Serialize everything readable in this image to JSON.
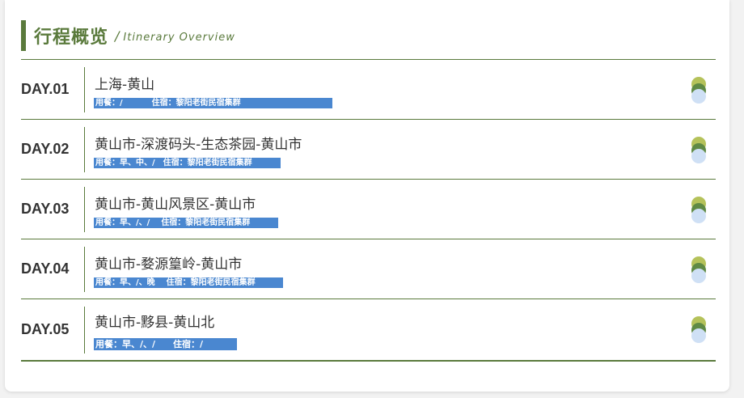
{
  "header": {
    "title": "行程概览",
    "separator": "/",
    "subtitle": "Itinerary Overview"
  },
  "colors": {
    "accent": "#5a7a3c",
    "meta_bg": "#4a87d0",
    "dot_top": "#b5c25a",
    "dot_mid": "#5f8a45",
    "dot_bottom": "#cfe0f5"
  },
  "days": [
    {
      "day": "DAY.01",
      "route": "上海-黄山",
      "meals_label": "用餐：/",
      "stay_label": "住宿：黎阳老街民宿集群",
      "icon": "dots-icon"
    },
    {
      "day": "DAY.02",
      "route": "黄山市-深渡码头-生态茶园-黄山市",
      "meals_label": "用餐：早、中、/",
      "stay_label": "住宿：黎阳老街民宿集群",
      "icon": "dots-icon"
    },
    {
      "day": "DAY.03",
      "route": "黄山市-黄山风景区-黄山市",
      "meals_label": "用餐：早、/、/",
      "stay_label": "住宿：黎阳老街民宿集群",
      "icon": "dots-icon"
    },
    {
      "day": "DAY.04",
      "route": "黄山市-婺源篁岭-黄山市",
      "meals_label": "用餐：早、/、晚",
      "stay_label": "住宿：黎阳老街民宿集群",
      "icon": "dots-icon"
    },
    {
      "day": "DAY.05",
      "route": "黄山市-黟县-黄山北",
      "meals_label": "用餐：早、/、/",
      "stay_label": "住宿：/",
      "icon": "dots-icon"
    }
  ]
}
